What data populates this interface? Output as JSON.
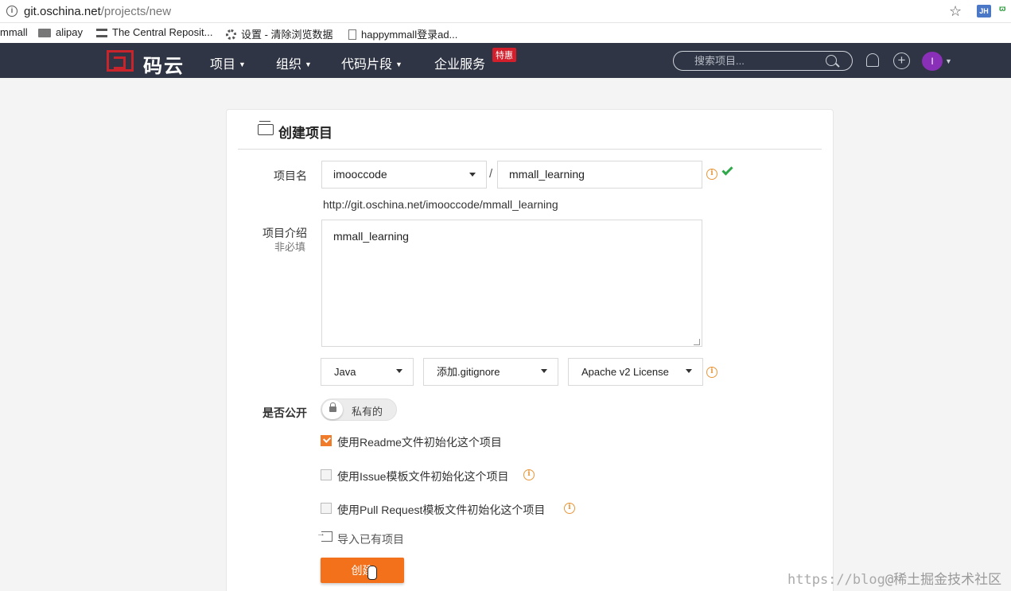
{
  "browser": {
    "url_host": "git.oschina.net",
    "url_path": "/projects/new",
    "ext_badge": "JH",
    "ext_badge2": "ϖ",
    "bookmarks": [
      "mmall",
      "alipay",
      "The Central Reposit...",
      "设置 - 清除浏览数据",
      "happymmall登录ad..."
    ]
  },
  "site": {
    "logo": "码云",
    "nav": [
      "项目",
      "组织",
      "代码片段",
      "企业服务"
    ],
    "hot_badge": "特惠",
    "search_placeholder": "搜索项目...",
    "avatar_letter": "I"
  },
  "form": {
    "title": "创建项目",
    "name_label": "项目名",
    "owner": "imooccode",
    "slash": "/",
    "project_name": "mmall_learning",
    "url_preview": "http://git.oschina.net/imooccode/mmall_learning",
    "desc_label": "项目介绍",
    "desc_sublabel": "非必填",
    "description": "mmall_learning",
    "language": "Java",
    "gitignore": "添加.gitignore",
    "license": "Apache v2 License",
    "public_label": "是否公开",
    "visibility": "私有的",
    "checkboxes": [
      {
        "label": "使用Readme文件初始化这个项目",
        "checked": true
      },
      {
        "label": "使用Issue模板文件初始化这个项目",
        "checked": false
      },
      {
        "label": "使用Pull Request模板文件初始化这个项目",
        "checked": false
      }
    ],
    "import_label": "导入已有项目",
    "submit": "创建"
  },
  "watermark": {
    "prefix": "https://blog",
    "suffix": "@稀土掘金技术社区"
  },
  "colors": {
    "navbar": "#2f3544",
    "brand_red": "#c7242b",
    "accent_orange": "#f4711c",
    "success_green": "#2fa84a"
  }
}
